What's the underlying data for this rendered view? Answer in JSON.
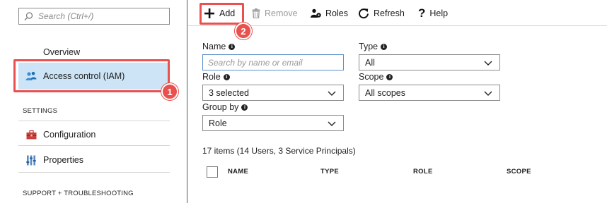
{
  "sidebar": {
    "search_placeholder": "Search (Ctrl+/)",
    "items": {
      "overview": "Overview",
      "access_control": "Access control (IAM)",
      "configuration": "Configuration",
      "properties": "Properties"
    },
    "sections": {
      "settings": "SETTINGS",
      "support": "SUPPORT + TROUBLESHOOTING"
    }
  },
  "toolbar": {
    "add_label": "Add",
    "remove_label": "Remove",
    "roles_label": "Roles",
    "refresh_label": "Refresh",
    "help_label": "Help"
  },
  "badges": {
    "one": "1",
    "two": "2"
  },
  "filters": {
    "name_label": "Name",
    "name_placeholder": "Search by name or email",
    "type_label": "Type",
    "type_value": "All",
    "role_label": "Role",
    "role_value": "3 selected",
    "scope_label": "Scope",
    "scope_value": "All scopes",
    "groupby_label": "Group by",
    "groupby_value": "Role"
  },
  "results": {
    "count_text": "17 items (14 Users, 3 Service Principals)",
    "columns": [
      "NAME",
      "TYPE",
      "ROLE",
      "SCOPE"
    ]
  },
  "colors": {
    "highlight": "#e8514d",
    "selected_nav": "#cce4f6",
    "input_focus": "#5a8fc8"
  }
}
